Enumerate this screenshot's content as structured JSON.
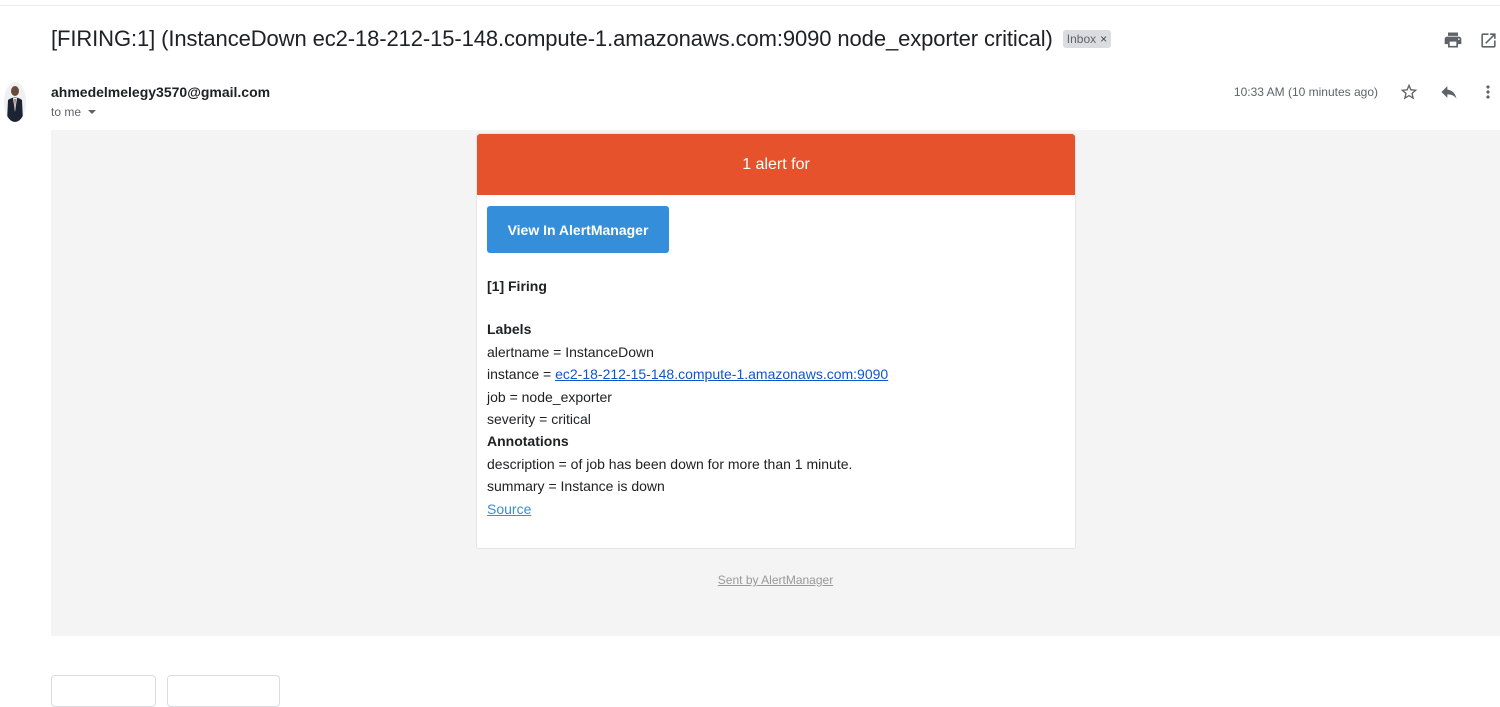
{
  "subject": "[FIRING:1] (InstanceDown ec2-18-212-15-148.compute-1.amazonaws.com:9090 node_exporter critical)",
  "label_chip": "Inbox",
  "label_remove": "×",
  "toolbar_icons": [
    "print-icon",
    "open-in-new-window-icon"
  ],
  "sender": {
    "email": "ahmedelmelegy3570@gmail.com",
    "to": "to me",
    "timestamp": "10:33 AM (10 minutes ago)"
  },
  "message_actions": [
    "star-icon",
    "reply-icon",
    "more-vert-icon"
  ],
  "alert": {
    "header": "1 alert for",
    "button_label": "View In AlertManager",
    "firing_title": "[1] Firing",
    "labels_heading": "Labels",
    "alertname_line": "alertname = InstanceDown",
    "instance_prefix": "instance = ",
    "instance_link": "ec2-18-212-15-148.compute-1.amazonaws.com:9090",
    "job_line": "job = node_exporter",
    "severity_line": "severity = critical",
    "annotations_heading": "Annotations",
    "description_line": "description = of job has been down for more than 1 minute.",
    "summary_line": "summary = Instance is down",
    "source_link": "Source",
    "footer": "Sent by AlertManager"
  },
  "colors": {
    "alert_header": "#e6522c",
    "button": "#348eda",
    "body_background": "#f4f4f4",
    "link": "#1155cc"
  }
}
